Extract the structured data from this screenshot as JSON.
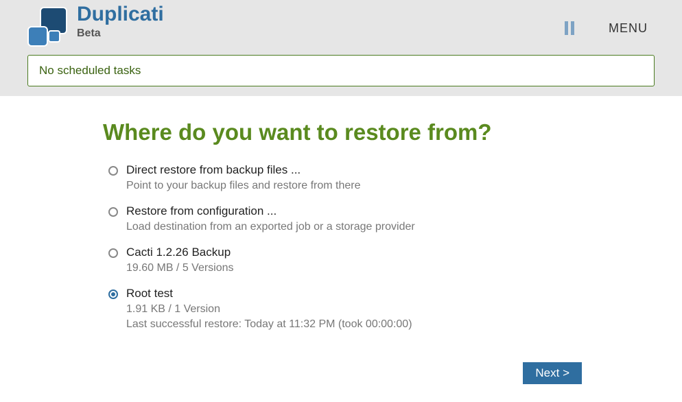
{
  "header": {
    "app_name": "Duplicati",
    "badge": "Beta",
    "menu_label": "MENU"
  },
  "status_banner": "No scheduled tasks",
  "page": {
    "heading": "Where do you want to restore from?",
    "options": [
      {
        "label": "Direct restore from backup files ...",
        "desc": "Point to your backup files and restore from there",
        "desc2": "",
        "selected": false
      },
      {
        "label": "Restore from configuration ...",
        "desc": "Load destination from an exported job or a storage provider",
        "desc2": "",
        "selected": false
      },
      {
        "label": "Cacti 1.2.26 Backup",
        "desc": "19.60 MB / 5 Versions",
        "desc2": "",
        "selected": false
      },
      {
        "label": "Root test",
        "desc": "1.91 KB / 1 Version",
        "desc2": "Last successful restore: Today at 11:32 PM (took 00:00:00)",
        "selected": true
      }
    ],
    "next_label": "Next >"
  }
}
